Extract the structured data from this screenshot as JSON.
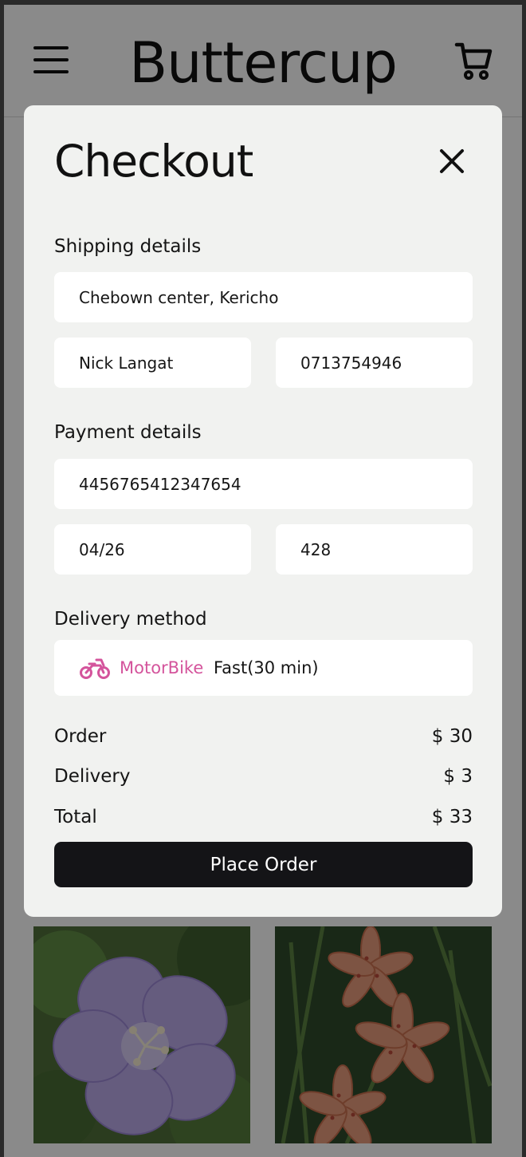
{
  "header": {
    "brand": "Buttercup",
    "menu_icon": "hamburger-menu-icon",
    "cart_icon": "shopping-cart-icon"
  },
  "checkout": {
    "title": "Checkout",
    "close_icon": "close-icon",
    "shipping": {
      "label": "Shipping details",
      "address": "Chebown center, Kericho",
      "name": "Nick Langat",
      "phone": "0713754946"
    },
    "payment": {
      "label": "Payment details",
      "card_number": "4456765412347654",
      "expiry": "04/26",
      "cvv": "428"
    },
    "delivery": {
      "label": "Delivery method",
      "option_icon": "motorbike-icon",
      "option_name": "MotorBike",
      "option_speed": "Fast(30 min)"
    },
    "summary": {
      "order_label": "Order",
      "order_value": "$ 30",
      "delivery_label": "Delivery",
      "delivery_value": "$ 3",
      "total_label": "Total",
      "total_value": "$ 33"
    },
    "place_order_label": "Place Order"
  },
  "colors": {
    "accent": "#d4549c",
    "button": "#141417",
    "modal_bg": "#f1f2f0"
  }
}
